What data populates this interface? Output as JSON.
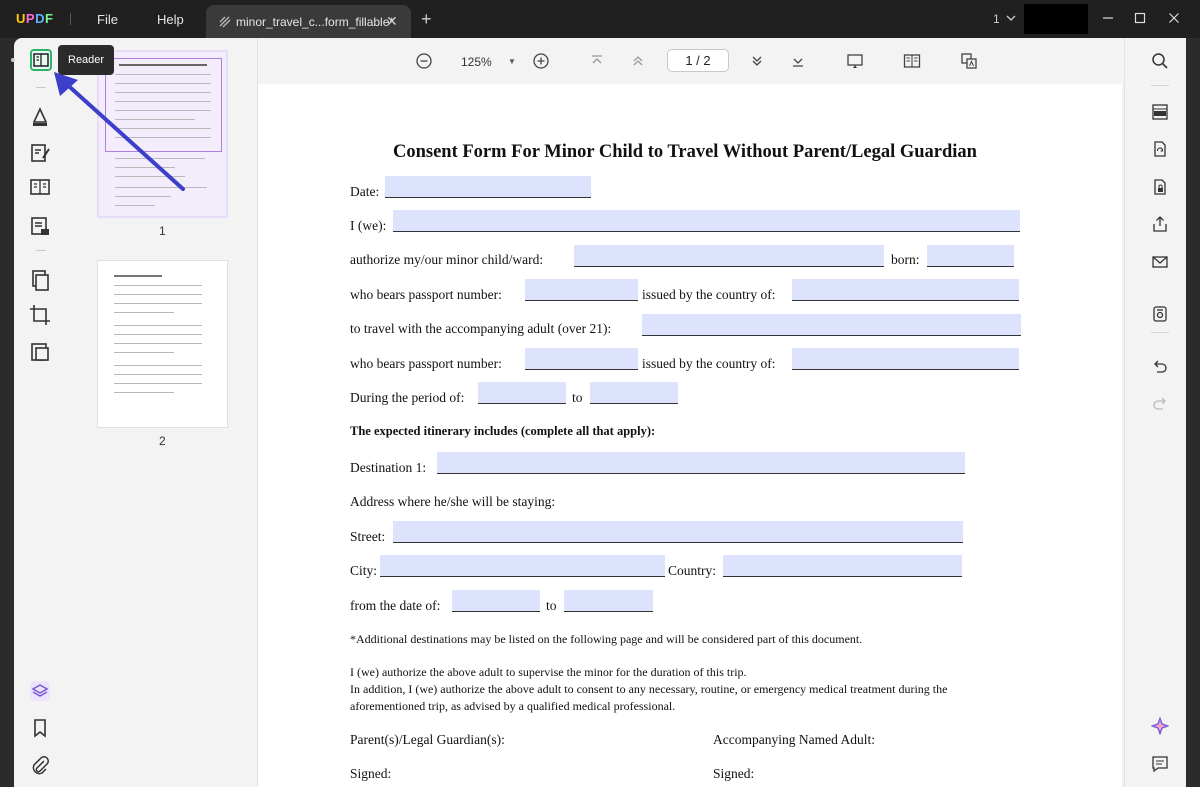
{
  "app": {
    "logo": "UPDF"
  },
  "menus": {
    "file": "File",
    "help": "Help"
  },
  "tab": {
    "label": "minor_travel_c...form_fillable*",
    "close": "✕",
    "add": "+"
  },
  "window": {
    "count": "1"
  },
  "tooltip": {
    "label": "Reader"
  },
  "toolbar": {
    "zoom": "125%",
    "page_current": "1",
    "page_total": "2",
    "page_label": "1 / 2"
  },
  "thumbnails": [
    {
      "number": "1",
      "selected": true
    },
    {
      "number": "2",
      "selected": false
    }
  ],
  "document": {
    "title": "Consent Form For Minor Child to Travel Without Parent/Legal Guardian",
    "date": "Date:",
    "i_we": "I (we):",
    "authorize": "authorize my/our minor child/ward:",
    "born": "born:",
    "passport_1": "who bears passport number:",
    "issued_1": "issued by the country of:",
    "travel_with": "to travel with the accompanying adult (over 21):",
    "passport_2": "who bears passport number:",
    "issued_2": "issued by the country of:",
    "period": "During the period of:",
    "to_1": "to",
    "itinerary": "The expected itinerary includes (complete all that apply):",
    "destination": "Destination 1:",
    "address": "Address where he/she will be staying:",
    "street": "Street:",
    "city": "City:",
    "country": "Country:",
    "from_date": "from the date of:",
    "to_2": "to",
    "additional": "*Additional destinations may be listed on the following page and will be considered part of this document.",
    "authorize_1": "I (we) authorize the above adult to supervise the minor for the duration of this trip.",
    "authorize_2": "In addition, I (we) authorize the above adult to consent to any necessary, routine, or emergency medical treatment during the",
    "authorize_3": "aforementioned trip, as advised by a qualified medical professional.",
    "parents": "Parent(s)/Legal Guardian(s):",
    "adult": "Accompanying Named Adult:",
    "signed_1": "Signed:",
    "signed_2": "Signed:"
  },
  "colors": {
    "field": "#dde3fd",
    "reader_accent": "#2fb36b",
    "arrow": "#3b3fc9",
    "tooltip_bg": "#2b2b2b",
    "titlebar": "#202020"
  },
  "icons": {
    "left": [
      "reader-icon",
      "comment-icon",
      "edit-pdf-icon",
      "organize-icon",
      "fill-sign-icon",
      "convert-icon",
      "crop-icon",
      "compress-icon",
      "layers-icon",
      "bookmark-icon",
      "attachment-icon"
    ],
    "toolbar": [
      "zoom-out-icon",
      "zoom-in-icon",
      "first-page-icon",
      "prev-page-icon",
      "next-page-icon",
      "last-page-icon",
      "presentation-icon",
      "two-page-view-icon",
      "translate-icon"
    ],
    "right": [
      "search-icon",
      "ocr-icon",
      "convert-icon",
      "protect-icon",
      "share-icon",
      "email-icon",
      "save-icon",
      "undo-icon",
      "redo-icon",
      "ai-assistant-icon",
      "comment-panel-icon"
    ]
  }
}
